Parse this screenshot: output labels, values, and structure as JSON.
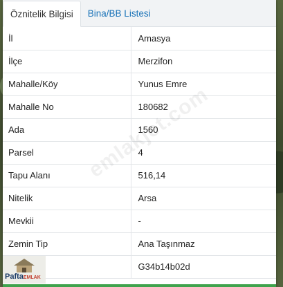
{
  "tabs": [
    {
      "label": "Öznitelik Bilgisi",
      "active": true
    },
    {
      "label": "Bina/BB Listesi",
      "active": false
    }
  ],
  "rows": [
    {
      "key": "İl",
      "value": "Amasya"
    },
    {
      "key": "İlçe",
      "value": "Merzifon"
    },
    {
      "key": "Mahalle/Köy",
      "value": "Yunus Emre"
    },
    {
      "key": "Mahalle No",
      "value": "180682"
    },
    {
      "key": "Ada",
      "value": "1560"
    },
    {
      "key": "Parsel",
      "value": "4"
    },
    {
      "key": "Tapu Alanı",
      "value": "516,14"
    },
    {
      "key": "Nitelik",
      "value": "Arsa"
    },
    {
      "key": "Mevkii",
      "value": "-"
    },
    {
      "key": "Zemin Tip",
      "value": "Ana Taşınmaz"
    },
    {
      "key": "",
      "value": "G34b14b02d"
    }
  ],
  "watermark": "emlakjet.com",
  "logo": {
    "text_main": "Pafta",
    "text_small": "EMLAK"
  },
  "colors": {
    "tab_link": "#1a73b8",
    "bottom_bar": "#3fa34d"
  }
}
